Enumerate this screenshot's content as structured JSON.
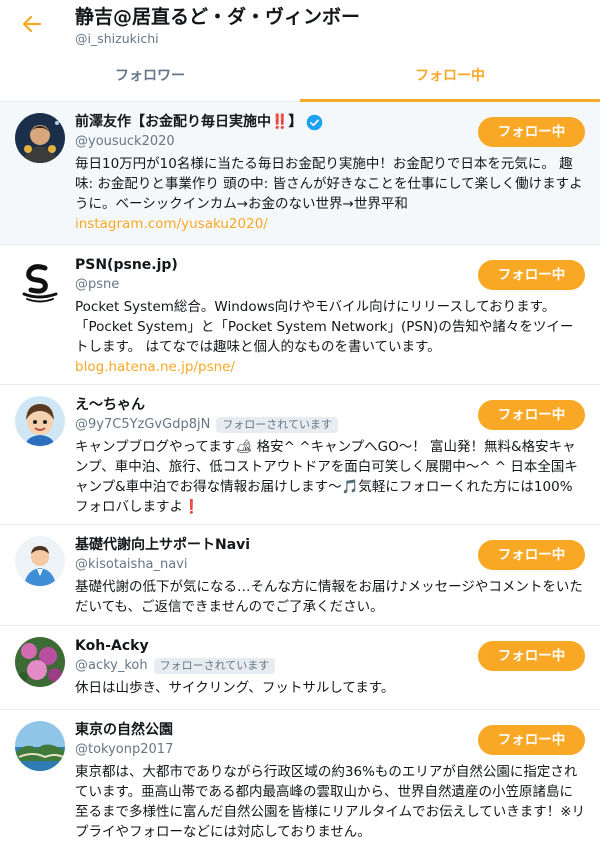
{
  "header": {
    "title": "静吉@居直るど・ダ・ヴィンボー",
    "handle": "@i_shizukichi"
  },
  "tabs": {
    "followers": "フォロワー",
    "following": "フォロー中"
  },
  "colors": {
    "accent": "#f9a825",
    "secondary_text": "#657786",
    "verified": "#1da1f2"
  },
  "users": [
    {
      "name": "前澤友作【お金配り毎日実施中‼️】",
      "handle": "@yousuck2020",
      "follows_you": "",
      "bio": "毎日10万円が10名様に当たる毎日お金配り実施中！お金配りで日本を元気に。 趣味: お金配りと事業作り 頭の中: 皆さんが好きなことを仕事にして楽しく働けますように。ベーシックインカム→お金のない世界→世界平和",
      "link": "instagram.com/yusaku2020/",
      "button": "フォロー中"
    },
    {
      "name": "PSN(psne.jp)",
      "handle": "@psne",
      "follows_you": "",
      "bio": "Pocket System総合。Windows向けやモバイル向けにリリースしております。「Pocket System」と「Pocket System Network」(PSN)の告知や諸々をツイートします。 はてなでは趣味と個人的なものを書いています。",
      "link": "blog.hatena.ne.jp/psne/",
      "button": "フォロー中"
    },
    {
      "name": "え～ちゃん",
      "handle": "@9y7C5YzGvGdp8jN",
      "follows_you": "フォローされています",
      "bio": "キャンプブログやってます🏕 格安^ ^キャンプへGO～！ 富山発！無料&格安キャンプ、車中泊、旅行、低コストアウトドアを面白可笑しく展開中～^ ^ 日本全国キャンプ&車中泊でお得な情報お届けします～🎵気軽にフォローくれた方には100%フォロバしますよ❗",
      "link": "",
      "button": "フォロー中"
    },
    {
      "name": "基礎代謝向上サポートNavi",
      "handle": "@kisotaisha_navi",
      "follows_you": "",
      "bio": "基礎代謝の低下が気になる…そんな方に情報をお届け♪メッセージやコメントをいただいても、ご返信できませんのでご了承ください。",
      "link": "",
      "button": "フォロー中"
    },
    {
      "name": "Koh-Acky",
      "handle": "@acky_koh",
      "follows_you": "フォローされています",
      "bio": "休日は山歩き、サイクリング、フットサルしてます。",
      "link": "",
      "button": "フォロー中"
    },
    {
      "name": "東京の自然公園",
      "handle": "@tokyonp2017",
      "follows_you": "",
      "bio": "東京都は、大都市でありながら行政区域の約36%ものエリアが自然公園に指定されています。亜高山帯である都内最高峰の雲取山から、世界自然遺産の小笠原諸島に至るまで多様性に富んだ自然公園を皆様にリアルタイムでお伝えしていきます！※リプライやフォローなどには対応しておりません。",
      "link": "",
      "button": "フォロー中"
    }
  ]
}
